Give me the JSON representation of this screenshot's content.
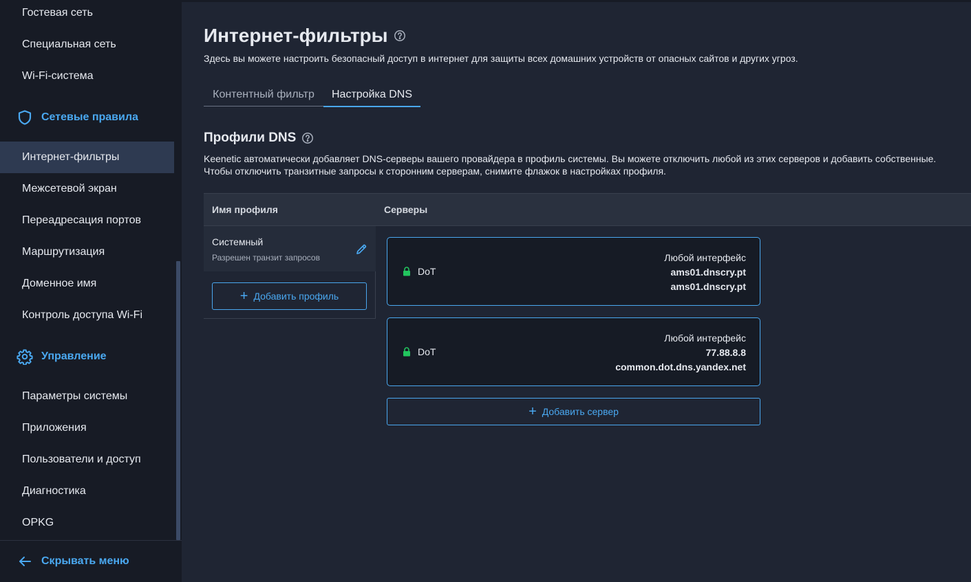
{
  "sidebar": {
    "items_top": [
      {
        "label": "Гостевая сеть"
      },
      {
        "label": "Специальная сеть"
      },
      {
        "label": "Wi-Fi-система"
      }
    ],
    "section_rules": {
      "label": "Сетевые правила",
      "icon": "shield-icon"
    },
    "items_rules": [
      {
        "label": "Интернет-фильтры",
        "active": true
      },
      {
        "label": "Межсетевой экран"
      },
      {
        "label": "Переадресация портов"
      },
      {
        "label": "Маршрутизация"
      },
      {
        "label": "Доменное имя"
      },
      {
        "label": "Контроль доступа Wi-Fi"
      }
    ],
    "section_manage": {
      "label": "Управление",
      "icon": "gear-icon"
    },
    "items_manage": [
      {
        "label": "Параметры системы"
      },
      {
        "label": "Приложения"
      },
      {
        "label": "Пользователи и доступ"
      },
      {
        "label": "Диагностика"
      },
      {
        "label": "OPKG"
      }
    ],
    "footer": {
      "label": "Скрывать меню",
      "icon": "arrow-left-icon"
    }
  },
  "page": {
    "title": "Интернет-фильтры",
    "description": "Здесь вы можете настроить безопасный доступ в интернет для защиты всех домашних устройств от опасных сайтов и других угроз.",
    "tabs": [
      {
        "label": "Контентный фильтр",
        "active": false
      },
      {
        "label": "Настройка DNS",
        "active": true
      }
    ]
  },
  "dns": {
    "title": "Профили DNS",
    "description_line1": "Keenetic автоматически добавляет DNS-серверы вашего провайдера в профиль системы. Вы можете отключить любой из этих серверов и добавить собственные.",
    "description_line2": "Чтобы отключить транзитные запросы к сторонним серверам, снимите флажок в настройках профиля.",
    "columns": {
      "profile": "Имя профиля",
      "servers": "Серверы"
    },
    "profiles": [
      {
        "name": "Системный",
        "subtitle": "Разрешен транзит запросов"
      }
    ],
    "add_profile_label": "Добавить профиль",
    "servers": [
      {
        "protocol": "DoT",
        "interface": "Любой интерфейс",
        "address": "ams01.dnscry.pt",
        "name": "ams01.dnscry.pt"
      },
      {
        "protocol": "DoT",
        "interface": "Любой интерфейс",
        "address": "77.88.8.8",
        "name": "common.dot.dns.yandex.net"
      }
    ],
    "add_server_label": "Добавить сервер"
  },
  "colors": {
    "accent": "#4aa8f0",
    "background": "#1f2533",
    "sidebar": "#171b25",
    "lock": "#22c55e"
  }
}
